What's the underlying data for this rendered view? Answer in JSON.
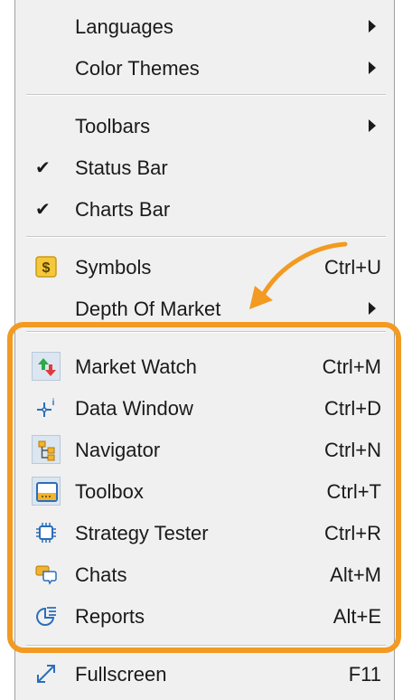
{
  "menu": {
    "items": [
      {
        "label": "Languages",
        "has_submenu": true,
        "checked": false
      },
      {
        "label": "Color Themes",
        "has_submenu": true,
        "checked": false
      },
      {
        "label": "Toolbars",
        "has_submenu": true,
        "checked": false
      },
      {
        "label": "Status Bar",
        "checked": true
      },
      {
        "label": "Charts Bar",
        "checked": true
      },
      {
        "label": "Symbols",
        "shortcut": "Ctrl+U",
        "icon": "dollar-icon"
      },
      {
        "label": "Depth Of Market",
        "has_submenu": true
      },
      {
        "label": "Market Watch",
        "shortcut": "Ctrl+M",
        "icon": "market-watch-icon"
      },
      {
        "label": "Data Window",
        "shortcut": "Ctrl+D",
        "icon": "crosshair-info-icon"
      },
      {
        "label": "Navigator",
        "shortcut": "Ctrl+N",
        "icon": "tree-icon"
      },
      {
        "label": "Toolbox",
        "shortcut": "Ctrl+T",
        "icon": "toolbox-icon"
      },
      {
        "label": "Strategy Tester",
        "shortcut": "Ctrl+R",
        "icon": "chip-icon"
      },
      {
        "label": "Chats",
        "shortcut": "Alt+M",
        "icon": "chat-icon"
      },
      {
        "label": "Reports",
        "shortcut": "Alt+E",
        "icon": "reports-icon"
      },
      {
        "label": "Fullscreen",
        "shortcut": "F11",
        "icon": "expand-icon"
      }
    ],
    "check_glyph": "✔"
  },
  "colors": {
    "highlight": "#f29a21",
    "menu_bg": "#f0f0f0"
  }
}
